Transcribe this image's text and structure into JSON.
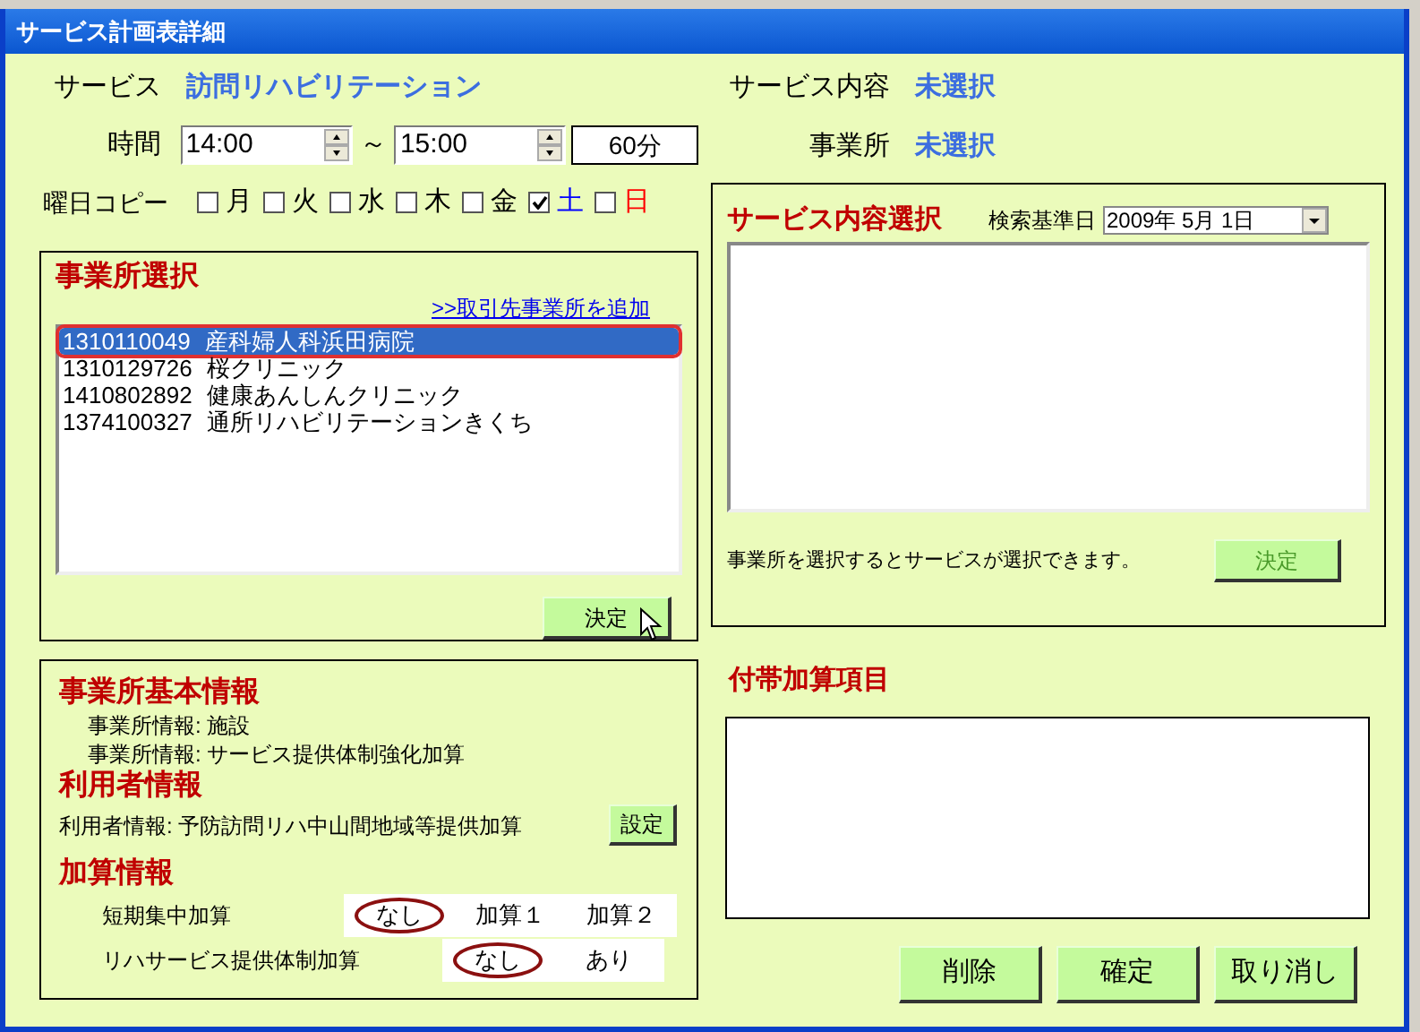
{
  "window": {
    "title": "サービス計画表詳細"
  },
  "service": {
    "label": "サービス",
    "value": "訪問リハビリテーション"
  },
  "time": {
    "label": "時間",
    "start": "14:00",
    "separator": "～",
    "end": "15:00",
    "duration": "60分"
  },
  "day_copy": {
    "label": "曜日コピー",
    "days": [
      {
        "label": "月",
        "checked": false,
        "color": "#000000"
      },
      {
        "label": "火",
        "checked": false,
        "color": "#000000"
      },
      {
        "label": "水",
        "checked": false,
        "color": "#000000"
      },
      {
        "label": "木",
        "checked": false,
        "color": "#000000"
      },
      {
        "label": "金",
        "checked": false,
        "color": "#000000"
      },
      {
        "label": "土",
        "checked": true,
        "color": "#0000ff"
      },
      {
        "label": "日",
        "checked": false,
        "color": "#ff0000"
      }
    ]
  },
  "service_content": {
    "label": "サービス内容",
    "value": "未選択"
  },
  "office": {
    "label": "事業所",
    "value": "未選択"
  },
  "office_select": {
    "title": "事業所選択",
    "add_link": ">>取引先事業所を追加",
    "items": [
      {
        "code": "1310110049",
        "name": "産科婦人科浜田病院",
        "selected": true
      },
      {
        "code": "1310129726",
        "name": "桜クリニック",
        "selected": false
      },
      {
        "code": "1410802892",
        "name": "健康あんしんクリニック",
        "selected": false
      },
      {
        "code": "1374100327",
        "name": "通所リハビリテーションきくち",
        "selected": false
      }
    ],
    "button": "決定"
  },
  "service_select": {
    "title": "サービス内容選択",
    "date_label": "検索基準日",
    "date": "2009年 5月 1日",
    "hint": "事業所を選択するとサービスが選択できます。",
    "button": "決定",
    "button_disabled": true
  },
  "office_info": {
    "title": "事業所基本情報",
    "lines": [
      "事業所情報: 施設",
      "事業所情報: サービス提供体制強化加算"
    ]
  },
  "user_info": {
    "title": "利用者情報",
    "line": "利用者情報: 予防訪問リハ中山間地域等提供加算",
    "button": "設定"
  },
  "addition_info": {
    "title": "加算情報",
    "groups": [
      {
        "label": "短期集中加算",
        "options": [
          {
            "label": "なし",
            "selected": true
          },
          {
            "label": "加算１",
            "selected": false
          },
          {
            "label": "加算２",
            "selected": false
          }
        ]
      },
      {
        "label": "リハサービス提供体制加算",
        "options": [
          {
            "label": "なし",
            "selected": true
          },
          {
            "label": "あり",
            "selected": false
          }
        ]
      }
    ]
  },
  "extra": {
    "title": "付帯加算項目"
  },
  "buttons": [
    "削除",
    "確定",
    "取り消し"
  ]
}
